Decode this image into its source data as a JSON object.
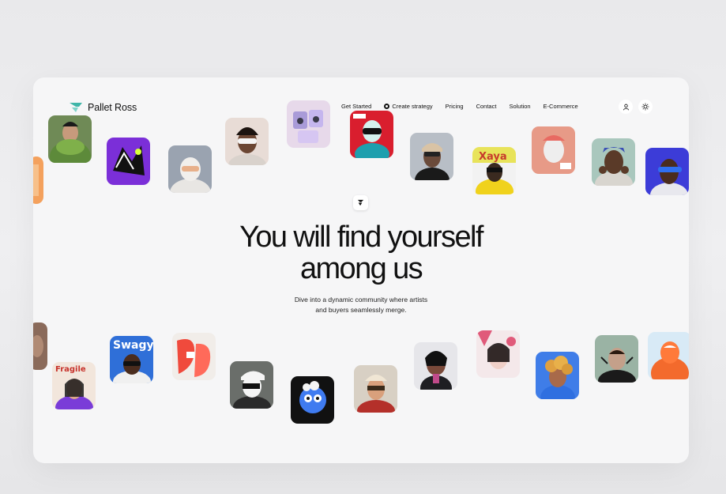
{
  "brand": {
    "name": "Pallet Ross",
    "accent": "#3fb5a8"
  },
  "nav": {
    "get_started": "Get Started",
    "create_strategy": "Create strategy",
    "pricing": "Pricing",
    "contact": "Contact",
    "solution": "Solution",
    "ecommerce": "E-Commerce"
  },
  "icons": {
    "account": "user-icon",
    "theme": "sun-icon",
    "badge": "brand-mark-icon"
  },
  "hero": {
    "headline_line1": "You will find yourself",
    "headline_line2": "among us",
    "sub_line1": "Dive into a dynamic community where artists",
    "sub_line2": "and buyers seamlessly merge."
  },
  "avatar_tiles": {
    "t10": "Xaya",
    "t16": "Swagy",
    "t17": "Fragile"
  }
}
